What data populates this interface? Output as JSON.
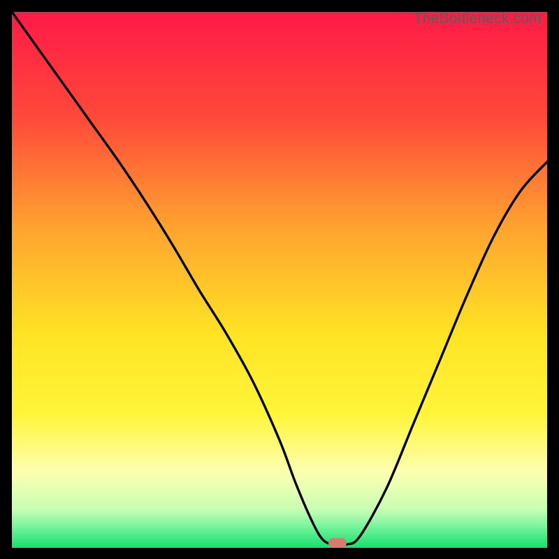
{
  "watermark": "TheBottleneck.com",
  "chart_data": {
    "type": "line",
    "title": "",
    "xlabel": "",
    "ylabel": "",
    "xlim": [
      0,
      100
    ],
    "ylim": [
      0,
      100
    ],
    "gradient_stops": [
      {
        "pos": 0.0,
        "color": "#ff1a46"
      },
      {
        "pos": 0.2,
        "color": "#ff4a3a"
      },
      {
        "pos": 0.4,
        "color": "#ffa22f"
      },
      {
        "pos": 0.6,
        "color": "#ffe324"
      },
      {
        "pos": 0.75,
        "color": "#fff53a"
      },
      {
        "pos": 0.86,
        "color": "#fdffb0"
      },
      {
        "pos": 0.93,
        "color": "#c6ffb4"
      },
      {
        "pos": 0.965,
        "color": "#6ef39a"
      },
      {
        "pos": 1.0,
        "color": "#19e06e"
      }
    ],
    "series": [
      {
        "name": "bottleneck-curve",
        "x": [
          0.0,
          5,
          10,
          15,
          20,
          25,
          30,
          35,
          40,
          45,
          50,
          53,
          56,
          58,
          60,
          62.5,
          65,
          70,
          75,
          80,
          85,
          90,
          95,
          100
        ],
        "y": [
          100,
          93,
          86,
          79,
          72,
          64.5,
          56.5,
          48,
          40,
          31,
          20,
          12,
          5,
          1.5,
          0.5,
          0.5,
          2,
          11,
          23,
          35,
          47,
          58,
          66.5,
          72
        ]
      }
    ],
    "marker": {
      "x": 60.8,
      "y": 0.8,
      "color": "#d87a70"
    }
  }
}
